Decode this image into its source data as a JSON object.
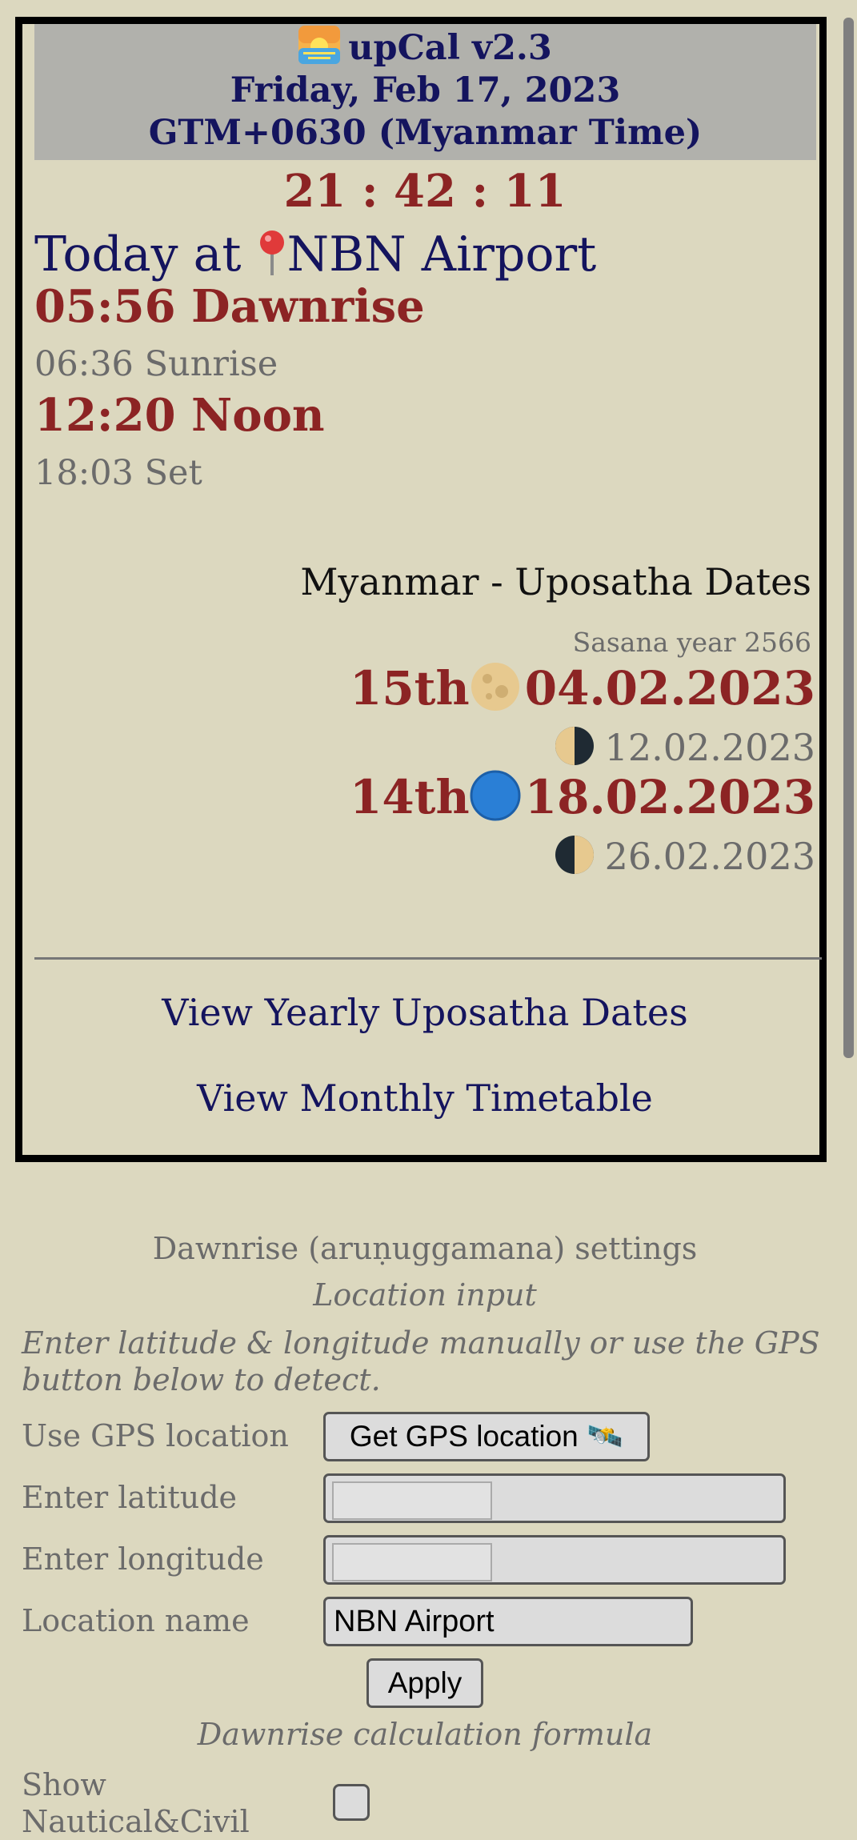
{
  "header": {
    "app_title": "upCal v2.3",
    "date": "Friday, Feb 17, 2023",
    "timezone": "GTM+0630 (Myanmar Time)",
    "icon": "sunrise-icon"
  },
  "clock": "21 : 42 : 11",
  "today": {
    "prefix": "Today at",
    "location": "NBN Airport",
    "icon": "round-pushpin-icon",
    "dawnrise": "05:56 Dawnrise",
    "sunrise": "06:36 Sunrise",
    "noon": "12:20 Noon",
    "set": "18:03 Set"
  },
  "uposatha": {
    "title": "Myanmar - Uposatha Dates",
    "sasana_year": "Sasana year 2566",
    "entries": [
      {
        "ordinal": "15th",
        "date": "04.02.2023",
        "moon": "full-moon-icon"
      },
      {
        "ordinal": "",
        "date": "12.02.2023",
        "moon": "last-quarter-moon-icon"
      },
      {
        "ordinal": "14th",
        "date": "18.02.2023",
        "moon": "new-moon-icon"
      },
      {
        "ordinal": "",
        "date": "26.02.2023",
        "moon": "first-quarter-moon-icon"
      }
    ]
  },
  "links": {
    "yearly": "View Yearly Uposatha Dates",
    "monthly": "View Monthly Timetable"
  },
  "settings": {
    "title": "Dawnrise (aruṇuggamana) settings",
    "location_input_heading": "Location input",
    "hint": "Enter latitude & longitude manually or use the GPS button below to detect.",
    "gps_label": "Use GPS location",
    "gps_button": "Get GPS location 🛰️",
    "lat_label": "Enter latitude",
    "lon_label": "Enter longitude",
    "name_label": "Location name",
    "name_value": "NBN Airport",
    "apply_button": "Apply",
    "formula_heading": "Dawnrise calculation formula",
    "show_label": "Show Nautical&Civil"
  },
  "colors": {
    "background": "#dcd8bf",
    "accent_red": "#8c2424",
    "navy": "#14145e",
    "header_bg": "#b1b1ac"
  }
}
